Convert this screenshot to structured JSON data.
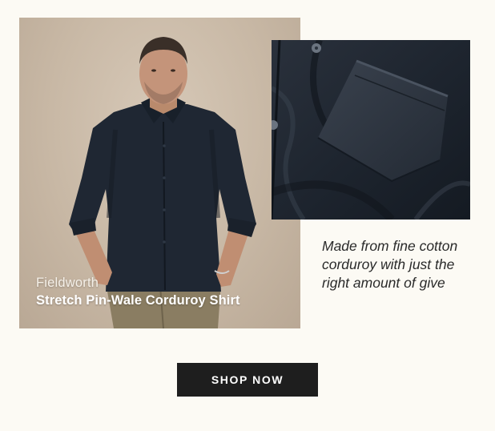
{
  "hero": {
    "brand": "Fieldworth",
    "product_name": "Stretch Pin-Wale Corduroy Shirt"
  },
  "tagline": "Made from fine cotton corduroy with just the right amount of give",
  "cta": {
    "label": "SHOP NOW"
  },
  "colors": {
    "page_background": "#fcfaf4",
    "button_background": "#1e1e1e",
    "shirt": "#1f2733",
    "pants": "#8a7d62",
    "backdrop": "#c8b8a5"
  }
}
